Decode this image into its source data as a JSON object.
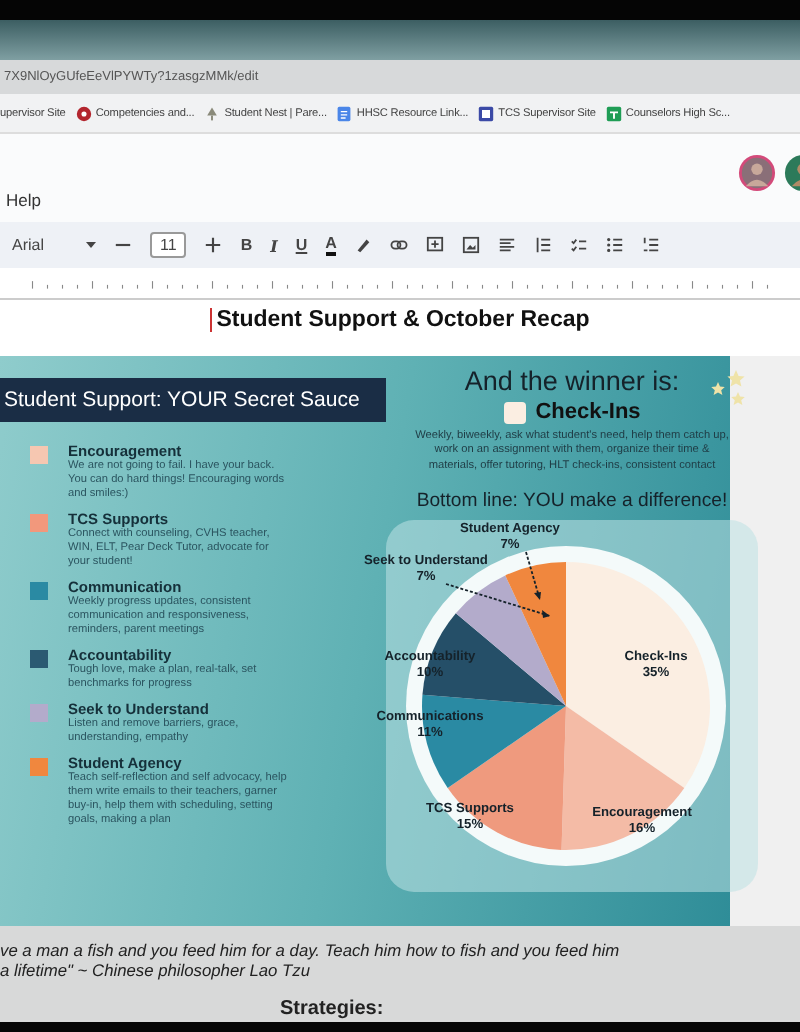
{
  "browser": {
    "url": "7X9NlOyGUfeEeVlPYWTy?1zasgzMMk/edit",
    "bookmarks": [
      {
        "label": "upervisor Site"
      },
      {
        "label": "Competencies and..."
      },
      {
        "label": "Student Nest | Pare..."
      },
      {
        "label": "HHSC Resource Link..."
      },
      {
        "label": "TCS Supervisor Site"
      },
      {
        "label": "Counselors High Sc..."
      }
    ]
  },
  "menu": {
    "items": [
      "Help"
    ]
  },
  "toolbar": {
    "font": "Arial",
    "size": "11",
    "format": [
      "B",
      "I",
      "U",
      "A"
    ]
  },
  "document": {
    "title": "Student Support & October Recap",
    "slide": {
      "title": "Student Support: YOUR Secret Sauce",
      "legend": [
        {
          "name": "Encouragement",
          "color": "#f6c7b1",
          "description": "We are not going to fail. I have your back. You can do hard things! Encouraging words and smiles:)"
        },
        {
          "name": "TCS Supports",
          "color": "#f2987c",
          "description": "Connect with counseling, CVHS teacher, WIN, ELT, Pear Deck Tutor, advocate for your student!"
        },
        {
          "name": "Communication",
          "color": "#2a8aa3",
          "description": "Weekly progress updates, consistent communication and responsiveness, reminders, parent meetings"
        },
        {
          "name": "Accountability",
          "color": "#2b5a72",
          "description": "Tough love, make a plan, real-talk, set benchmarks for progress"
        },
        {
          "name": "Seek to Understand",
          "color": "#b3abcb",
          "description": "Listen and remove barriers, grace, understanding, empathy"
        },
        {
          "name": "Student Agency",
          "color": "#f0873e",
          "description": "Teach self-reflection and self advocacy, help them write emails to their teachers, garner buy-in, help them with scheduling, setting goals, making a plan"
        }
      ],
      "winner_heading": "And the winner is:",
      "winner": {
        "name": "Check-Ins",
        "color": "#fbeee2",
        "description": "Weekly, biweekly, ask what student's need, help them catch up, work on an assignment with them, organize their time & materials, offer tutoring, HLT check-ins, consistent contact"
      },
      "bottom_line": "Bottom line: YOU make a difference!",
      "chart_data": {
        "type": "pie",
        "categories": [
          "Check-Ins",
          "Encouragement",
          "TCS Supports",
          "Communications",
          "Accountability",
          "Seek to Understand",
          "Student Agency"
        ],
        "values": [
          35,
          16,
          15,
          11,
          10,
          7,
          7
        ],
        "colors": [
          "#fbeee2",
          "#f4bba6",
          "#ef9a7e",
          "#2a8aa3",
          "#254f68",
          "#b3abcb",
          "#f0873e"
        ],
        "value_labels": [
          "35%",
          "16%",
          "15%",
          "11%",
          "10%",
          "7%",
          "7%"
        ]
      }
    },
    "quote_lines": [
      "ve a man a fish and you feed him for a day. Teach him how to fish and you feed him",
      "a lifetime\"  ~ Chinese philosopher Lao Tzu"
    ],
    "next_heading": "Strategies:"
  }
}
